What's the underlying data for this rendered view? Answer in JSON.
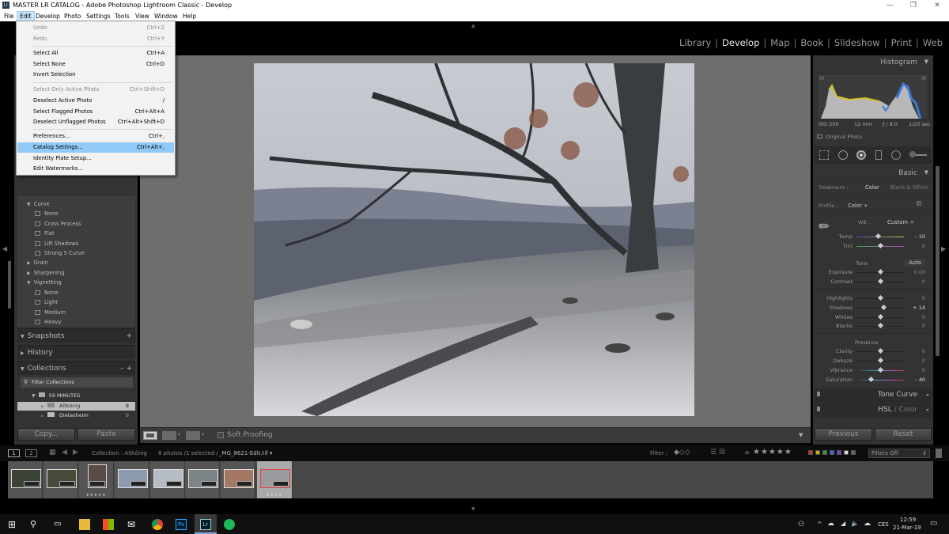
{
  "window": {
    "app_icon_label": "Lr",
    "title": "MASTER LR CATALOG - Adobe Photoshop Lightroom Classic - Develop",
    "controls": {
      "minimize": "—",
      "maximize": "❐",
      "close": "✕"
    }
  },
  "menubar": [
    "File",
    "Edit",
    "Develop",
    "Photo",
    "Settings",
    "Tools",
    "View",
    "Window",
    "Help"
  ],
  "edit_menu": [
    {
      "label": "Undo",
      "shortcut": "Ctrl+Z",
      "disabled": true
    },
    {
      "label": "Redo",
      "shortcut": "Ctrl+Y",
      "disabled": true
    },
    {
      "label": "Select All",
      "shortcut": "Ctrl+A"
    },
    {
      "label": "Select None",
      "shortcut": "Ctrl+D"
    },
    {
      "label": "Invert Selection",
      "shortcut": ""
    },
    {
      "label": "Select Only Active Photo",
      "shortcut": "Ctrl+Shift+D",
      "disabled": true
    },
    {
      "label": "Deselect Active Photo",
      "shortcut": "/"
    },
    {
      "label": "Select Flagged Photos",
      "shortcut": "Ctrl+Alt+A"
    },
    {
      "label": "Deselect Unflagged Photos",
      "shortcut": "Ctrl+Alt+Shift+D"
    },
    {
      "label": "Preferences...",
      "shortcut": "Ctrl+,"
    },
    {
      "label": "Catalog Settings...",
      "shortcut": "Ctrl+Alt+,",
      "highlighted": true
    },
    {
      "label": "Identity Plate Setup...",
      "shortcut": ""
    },
    {
      "label": "Edit Watermarks...",
      "shortcut": ""
    }
  ],
  "modules": [
    "Library",
    "Develop",
    "Map",
    "Book",
    "Slideshow",
    "Print",
    "Web"
  ],
  "active_module": "Develop",
  "presets": {
    "groups": [
      {
        "name": "Curve",
        "expanded": true,
        "items": [
          "None",
          "Cross Process",
          "Flat",
          "Lift Shadows",
          "Strong S Curve"
        ]
      },
      {
        "name": "Grain",
        "expanded": false,
        "items": []
      },
      {
        "name": "Sharpening",
        "expanded": false,
        "items": []
      },
      {
        "name": "Vignetting",
        "expanded": true,
        "items": [
          "None",
          "Light",
          "Medium",
          "Heavy"
        ]
      }
    ]
  },
  "left_sections": {
    "snapshots": "Snapshots",
    "history": "History",
    "collections": "Collections",
    "filter_collections": "Filter Collections",
    "collection_set": "59 MINUTES",
    "collections_list": [
      {
        "name": "Altkönig",
        "count": "8",
        "selected": true
      },
      {
        "name": "Dietesheim",
        "count": "6",
        "selected": false
      }
    ],
    "copy_button": "Copy...",
    "paste_button": "Paste"
  },
  "right_panel": {
    "histogram_title": "Histogram",
    "exif": {
      "iso": "ISO 200",
      "focal": "12 mm",
      "aperture": "ƒ / 8.0",
      "shutter": "1/20 sec"
    },
    "original_photo": "Original Photo",
    "basic_title": "Basic",
    "treatment_label": "Treatment :",
    "treatment_color": "Color",
    "treatment_bw": "Black & White",
    "profile_label": "Profile :",
    "profile_value": "Color ÷",
    "wb_label": "WB :",
    "wb_value": "Custom ÷",
    "tone_label": "Tone",
    "auto_label": "Auto",
    "presence_label": "Presence",
    "sliders": [
      {
        "name": "Temp",
        "value": "– 10",
        "pos": 0.45
      },
      {
        "name": "Tint",
        "value": "0",
        "pos": 0.5
      },
      {
        "name": "Exposure",
        "value": "0.00",
        "pos": 0.5
      },
      {
        "name": "Contrast",
        "value": "0",
        "pos": 0.5
      },
      {
        "name": "Highlights",
        "value": "0",
        "pos": 0.5
      },
      {
        "name": "Shadows",
        "value": "+ 14",
        "pos": 0.57
      },
      {
        "name": "Whites",
        "value": "0",
        "pos": 0.5
      },
      {
        "name": "Blacks",
        "value": "0",
        "pos": 0.5
      },
      {
        "name": "Clarity",
        "value": "0",
        "pos": 0.5
      },
      {
        "name": "Dehaze",
        "value": "0",
        "pos": 0.5
      },
      {
        "name": "Vibrance",
        "value": "0",
        "pos": 0.5
      },
      {
        "name": "Saturation",
        "value": "– 40",
        "pos": 0.3
      }
    ],
    "tone_curve_title": "Tone Curve",
    "hsl_title": "HSL",
    "hsl_color": " / Color",
    "previous_button": "Previous",
    "reset_button": "Reset"
  },
  "center_toolbar": {
    "soft_proofing": "Soft Proofing"
  },
  "filmstrip_bar": {
    "screen1": "1",
    "screen2": "2",
    "collection": "Collection : Altkönig",
    "count": "8 photos /1 selected /",
    "filename": "_MG_8621-Edit.tif ▾",
    "filter_label": "Filter :",
    "rating_op": "≥",
    "stars": "★★★★★",
    "filters_off": "Filters Off",
    "color_labels": [
      "#c0392b",
      "#c8b400",
      "#2e9e3a",
      "#2f6fcf",
      "#7a3fbf",
      "#dddddd",
      "#666666"
    ]
  },
  "filmstrip": {
    "thumbnails": [
      {
        "tone": "#3b4236",
        "stars": ""
      },
      {
        "tone": "#4a4a3a",
        "stars": ""
      },
      {
        "tone": "#5a4a48",
        "stars": "•••••"
      },
      {
        "tone": "#8d9bb0",
        "stars": ""
      },
      {
        "tone": "#b5bcc4",
        "stars": ""
      },
      {
        "tone": "#7e8589",
        "stars": ""
      },
      {
        "tone": "#a57865",
        "stars": ""
      },
      {
        "tone": "#9a9ca0",
        "stars": "••••",
        "selected": true
      }
    ]
  },
  "taskbar": {
    "tray": {
      "lang": "CES",
      "time": "12:59",
      "date": "21-Mar-19"
    }
  }
}
